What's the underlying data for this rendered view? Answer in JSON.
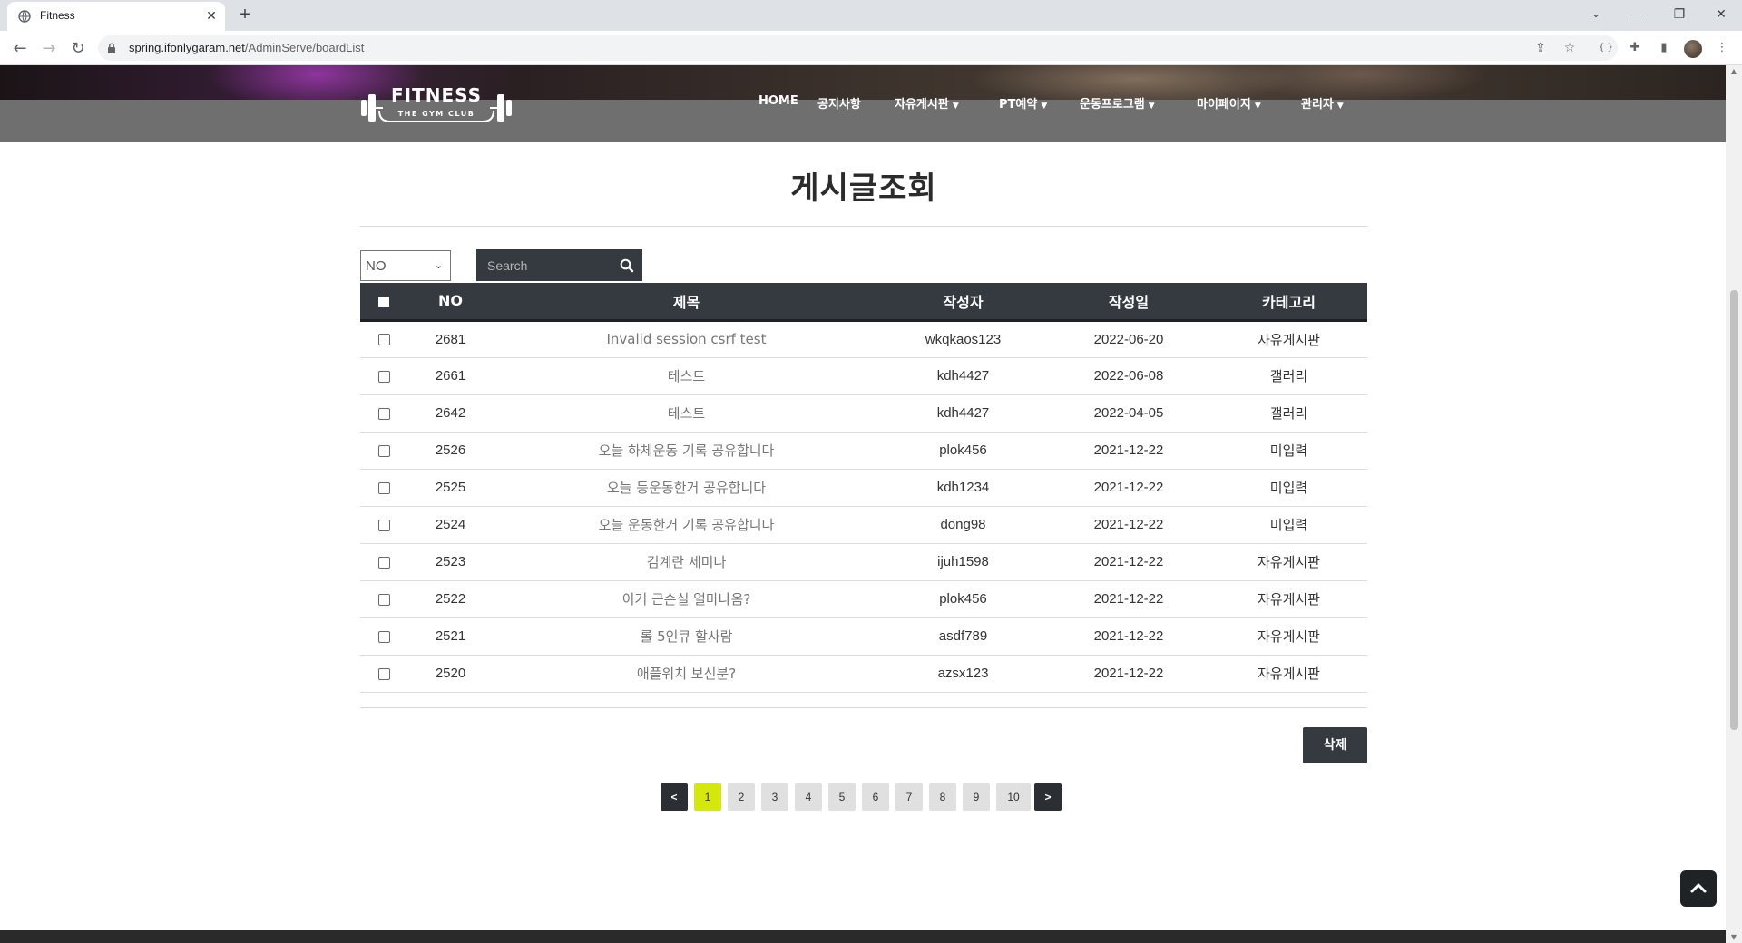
{
  "browser": {
    "tab_title": "Fitness",
    "tab_close": "✕",
    "new_tab": "+",
    "url_host": "spring.ifonlygaram.net",
    "url_path": "/AdminServe/boardList",
    "window_controls": {
      "minimize": "—",
      "restore": "❐",
      "close": "✕"
    }
  },
  "site": {
    "logo_text": "FITNESS",
    "logo_subtext": "THE GYM CLUB",
    "nav": [
      {
        "label": "HOME",
        "dropdown": false
      },
      {
        "label": "공지사항",
        "dropdown": false
      },
      {
        "label": "자유게시판",
        "dropdown": true
      },
      {
        "label": "PT예약",
        "dropdown": true
      },
      {
        "label": "운동프로그램",
        "dropdown": true
      },
      {
        "label": "마이페이지",
        "dropdown": true
      },
      {
        "label": "관리자",
        "dropdown": true
      }
    ]
  },
  "page": {
    "title": "게시글조회",
    "search": {
      "select_value": "NO",
      "placeholder": "Search"
    },
    "table": {
      "headers": [
        "NO",
        "제목",
        "작성자",
        "작성일",
        "카테고리"
      ],
      "rows": [
        {
          "no": "2681",
          "title": "Invalid session csrf test",
          "writer": "wkqkaos123",
          "date": "2022-06-20",
          "category": "자유게시판"
        },
        {
          "no": "2661",
          "title": "테스트",
          "writer": "kdh4427",
          "date": "2022-06-08",
          "category": "갤러리"
        },
        {
          "no": "2642",
          "title": "테스트",
          "writer": "kdh4427",
          "date": "2022-04-05",
          "category": "갤러리"
        },
        {
          "no": "2526",
          "title": "오늘 하체운동 기록 공유합니다",
          "writer": "plok456",
          "date": "2021-12-22",
          "category": "미입력"
        },
        {
          "no": "2525",
          "title": "오늘 등운동한거 공유합니다",
          "writer": "kdh1234",
          "date": "2021-12-22",
          "category": "미입력"
        },
        {
          "no": "2524",
          "title": "오늘 운동한거 기록 공유합니다",
          "writer": "dong98",
          "date": "2021-12-22",
          "category": "미입력"
        },
        {
          "no": "2523",
          "title": "김계란 세미나",
          "writer": "ijuh1598",
          "date": "2021-12-22",
          "category": "자유게시판"
        },
        {
          "no": "2522",
          "title": "이거 근손실 얼마나옴?",
          "writer": "plok456",
          "date": "2021-12-22",
          "category": "자유게시판"
        },
        {
          "no": "2521",
          "title": "롤 5인큐 할사람",
          "writer": "asdf789",
          "date": "2021-12-22",
          "category": "자유게시판"
        },
        {
          "no": "2520",
          "title": "애플워치 보신분?",
          "writer": "azsx123",
          "date": "2021-12-22",
          "category": "자유게시판"
        }
      ]
    },
    "delete_label": "삭제",
    "pagination": {
      "prev": "<",
      "next": ">",
      "pages": [
        "1",
        "2",
        "3",
        "4",
        "5",
        "6",
        "7",
        "8",
        "9",
        "10"
      ],
      "current": "1"
    }
  },
  "colors": {
    "accent": "#d4e810",
    "dark": "#343a40",
    "header_band": "#6f6f6f"
  }
}
